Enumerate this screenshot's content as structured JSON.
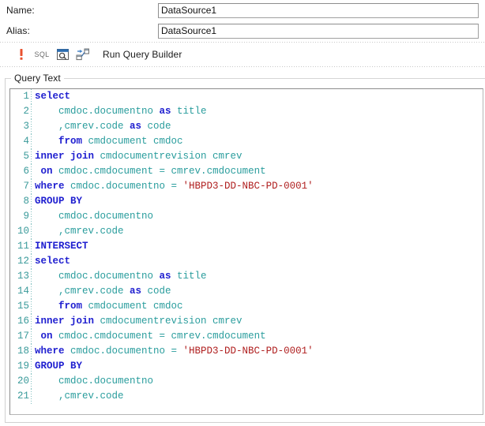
{
  "form": {
    "name": {
      "label": "Name:",
      "value": "DataSource1"
    },
    "alias": {
      "label": "Alias:",
      "value": "DataSource1"
    }
  },
  "toolbar": {
    "run_icon": "run-exclamation-icon",
    "sql_icon": "sql-text-icon",
    "sql_icon_text": "SQL",
    "preview_icon": "preview-magnifier-icon",
    "builder_icon": "query-builder-diagram-icon",
    "label": "Run Query Builder"
  },
  "groupbox": {
    "title": "Query Text"
  },
  "editor": {
    "lines": [
      {
        "n": "1",
        "tokens": [
          {
            "t": "select",
            "c": "kw"
          }
        ]
      },
      {
        "n": "2",
        "tokens": [
          {
            "t": "    cmdoc.documentno ",
            "c": "id"
          },
          {
            "t": "as",
            "c": "kw"
          },
          {
            "t": " title",
            "c": "id"
          }
        ]
      },
      {
        "n": "3",
        "tokens": [
          {
            "t": "    ,cmrev.code ",
            "c": "id"
          },
          {
            "t": "as",
            "c": "kw"
          },
          {
            "t": " code",
            "c": "id"
          }
        ]
      },
      {
        "n": "4",
        "tokens": [
          {
            "t": "    ",
            "c": "id"
          },
          {
            "t": "from",
            "c": "kw"
          },
          {
            "t": " cmdocument cmdoc",
            "c": "id"
          }
        ]
      },
      {
        "n": "5",
        "tokens": [
          {
            "t": "inner join",
            "c": "kw"
          },
          {
            "t": " cmdocumentrevision cmrev",
            "c": "id"
          }
        ]
      },
      {
        "n": "6",
        "tokens": [
          {
            "t": " ",
            "c": "id"
          },
          {
            "t": "on",
            "c": "kw"
          },
          {
            "t": " cmdoc.cmdocument = cmrev.cmdocument",
            "c": "id"
          }
        ]
      },
      {
        "n": "7",
        "tokens": [
          {
            "t": "where",
            "c": "kw"
          },
          {
            "t": " cmdoc.documentno = ",
            "c": "id"
          },
          {
            "t": "'HBPD3-DD-NBC-PD-0001'",
            "c": "str"
          }
        ]
      },
      {
        "n": "8",
        "tokens": [
          {
            "t": "GROUP BY",
            "c": "kw"
          }
        ]
      },
      {
        "n": "9",
        "tokens": [
          {
            "t": "    cmdoc.documentno",
            "c": "id"
          }
        ]
      },
      {
        "n": "10",
        "tokens": [
          {
            "t": "    ,cmrev.code",
            "c": "id"
          }
        ]
      },
      {
        "n": "11",
        "tokens": [
          {
            "t": "INTERSECT",
            "c": "kw"
          }
        ]
      },
      {
        "n": "12",
        "tokens": [
          {
            "t": "select",
            "c": "kw"
          }
        ]
      },
      {
        "n": "13",
        "tokens": [
          {
            "t": "    cmdoc.documentno ",
            "c": "id"
          },
          {
            "t": "as",
            "c": "kw"
          },
          {
            "t": " title",
            "c": "id"
          }
        ]
      },
      {
        "n": "14",
        "tokens": [
          {
            "t": "    ,cmrev.code ",
            "c": "id"
          },
          {
            "t": "as",
            "c": "kw"
          },
          {
            "t": " code",
            "c": "id"
          }
        ]
      },
      {
        "n": "15",
        "tokens": [
          {
            "t": "    ",
            "c": "id"
          },
          {
            "t": "from",
            "c": "kw"
          },
          {
            "t": " cmdocument cmdoc",
            "c": "id"
          }
        ]
      },
      {
        "n": "16",
        "tokens": [
          {
            "t": "inner join",
            "c": "kw"
          },
          {
            "t": " cmdocumentrevision cmrev",
            "c": "id"
          }
        ]
      },
      {
        "n": "17",
        "tokens": [
          {
            "t": " ",
            "c": "id"
          },
          {
            "t": "on",
            "c": "kw"
          },
          {
            "t": " cmdoc.cmdocument = cmrev.cmdocument",
            "c": "id"
          }
        ]
      },
      {
        "n": "18",
        "tokens": [
          {
            "t": "where",
            "c": "kw"
          },
          {
            "t": " cmdoc.documentno = ",
            "c": "id"
          },
          {
            "t": "'HBPD3-DD-NBC-PD-0001'",
            "c": "str"
          }
        ]
      },
      {
        "n": "19",
        "tokens": [
          {
            "t": "GROUP BY",
            "c": "kw"
          }
        ]
      },
      {
        "n": "20",
        "tokens": [
          {
            "t": "    cmdoc.documentno",
            "c": "id"
          }
        ]
      },
      {
        "n": "21",
        "tokens": [
          {
            "t": "    ,cmrev.code",
            "c": "id"
          }
        ]
      }
    ]
  },
  "colors": {
    "keyword": "#2020d0",
    "identifier": "#2a9d9d",
    "string": "#b02020",
    "line_number": "#3a9a9a",
    "run_icon": "#e8512e",
    "preview_icon": "#2b6cb0"
  }
}
